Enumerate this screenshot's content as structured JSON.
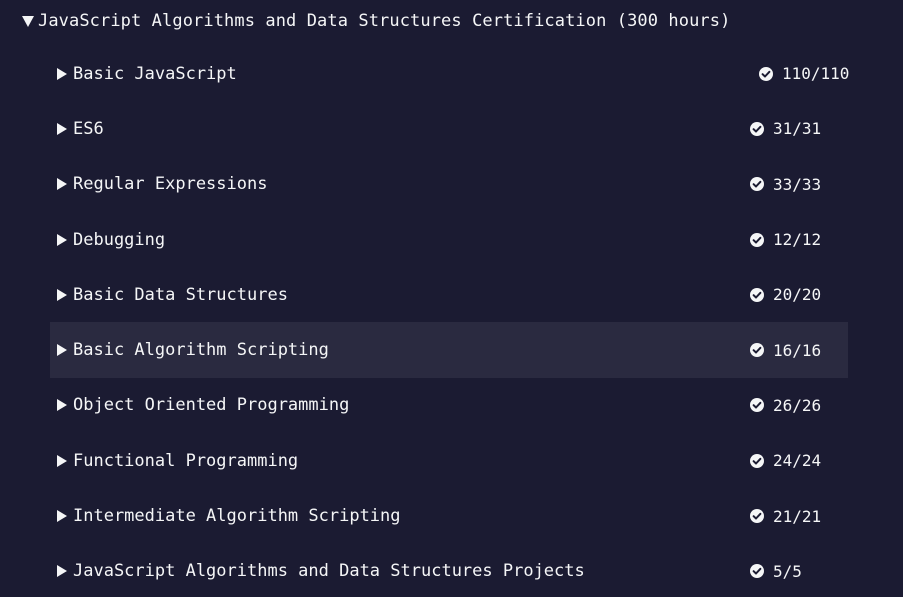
{
  "certification": {
    "title": "JavaScript Algorithms and Data Structures Certification (300 hours)",
    "expanded": true
  },
  "blocks": [
    {
      "label": "Basic JavaScript",
      "progress": "110/110",
      "complete": true
    },
    {
      "label": "ES6",
      "progress": "31/31",
      "complete": true
    },
    {
      "label": "Regular Expressions",
      "progress": "33/33",
      "complete": true
    },
    {
      "label": "Debugging",
      "progress": "12/12",
      "complete": true
    },
    {
      "label": "Basic Data Structures",
      "progress": "20/20",
      "complete": true
    },
    {
      "label": "Basic Algorithm Scripting",
      "progress": "16/16",
      "complete": true,
      "highlighted": true
    },
    {
      "label": "Object Oriented Programming",
      "progress": "26/26",
      "complete": true
    },
    {
      "label": "Functional Programming",
      "progress": "24/24",
      "complete": true
    },
    {
      "label": "Intermediate Algorithm Scripting",
      "progress": "21/21",
      "complete": true
    },
    {
      "label": "JavaScript Algorithms and Data Structures Projects",
      "progress": "5/5",
      "complete": true
    }
  ],
  "icons": {
    "header_caret": "caret-down-icon",
    "row_caret": "caret-right-icon",
    "status": "check-circle-icon"
  },
  "colors": {
    "background": "#1b1b32",
    "highlight": "#2a2a40",
    "text": "#f5f6f7"
  }
}
